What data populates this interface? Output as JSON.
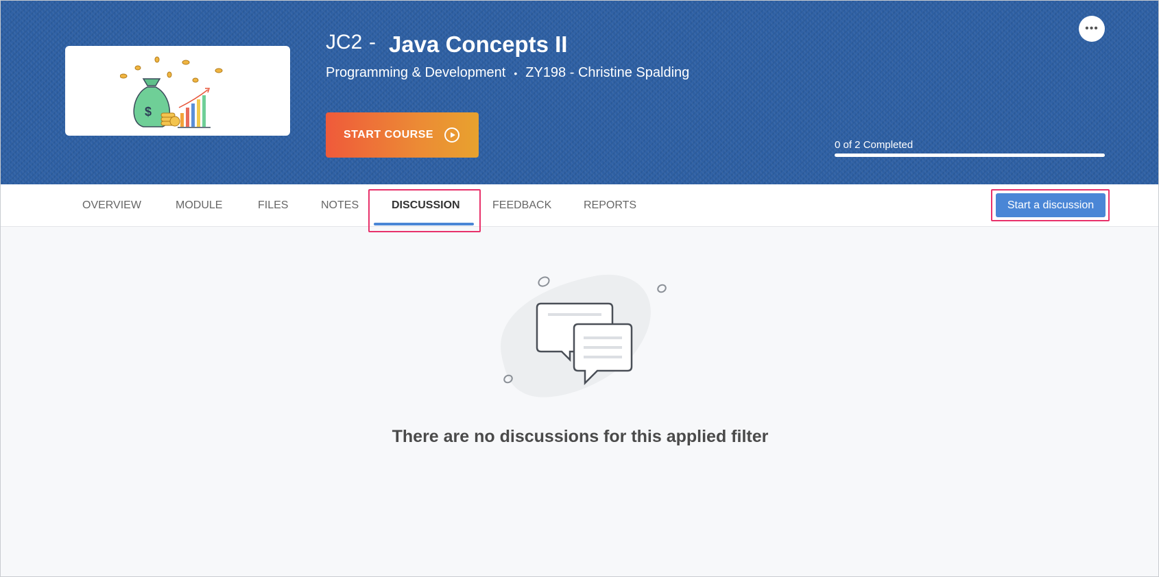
{
  "course": {
    "code": "JC2",
    "separator": "-",
    "title": "Java Concepts II",
    "category": "Programming & Development",
    "dot": "•",
    "instructor": "ZY198 - Christine Spalding",
    "start_label": "START COURSE",
    "more_label": "•••"
  },
  "progress": {
    "text": "0 of 2 Completed",
    "fraction": 1.0
  },
  "tabs": [
    {
      "label": "OVERVIEW"
    },
    {
      "label": "MODULE"
    },
    {
      "label": "FILES"
    },
    {
      "label": "NOTES"
    },
    {
      "label": "DISCUSSION"
    },
    {
      "label": "FEEDBACK"
    },
    {
      "label": "REPORTS"
    }
  ],
  "active_tab": "DISCUSSION",
  "actions": {
    "start_discussion": "Start a discussion"
  },
  "empty_state": {
    "message": "There are no discussions for this applied filter"
  },
  "colors": {
    "banner": "#2d5fa3",
    "accent": "#4a86d6",
    "highlight": "#e8316a",
    "start_gradient_from": "#ef5a3a",
    "start_gradient_to": "#e8a22e"
  }
}
